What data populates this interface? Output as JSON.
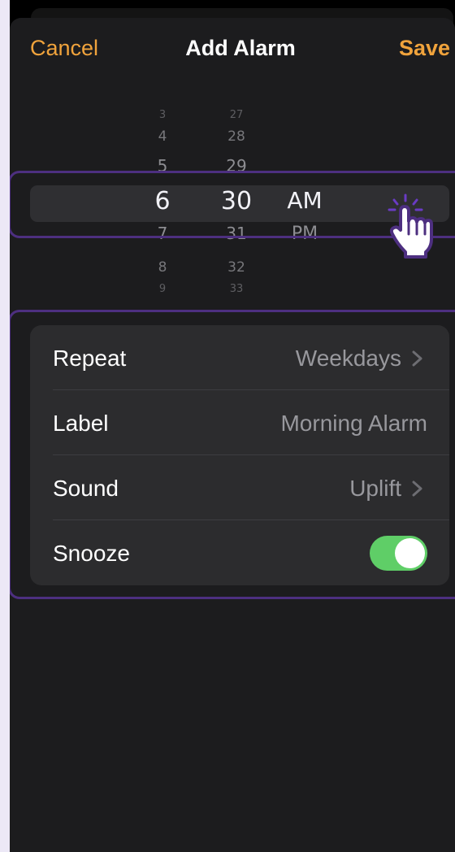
{
  "header": {
    "cancel": "Cancel",
    "title": "Add Alarm",
    "save": "Save"
  },
  "picker": {
    "hours": [
      "3",
      "4",
      "5",
      "6",
      "7",
      "8",
      "9"
    ],
    "minutes": [
      "27",
      "28",
      "29",
      "30",
      "31",
      "32",
      "33"
    ],
    "period": [
      "AM",
      "PM"
    ],
    "selected": {
      "hour": "6",
      "minute": "30",
      "period": "AM"
    }
  },
  "settings": {
    "repeat": {
      "label": "Repeat",
      "value": "Weekdays"
    },
    "label": {
      "label": "Label",
      "value": "Morning Alarm"
    },
    "sound": {
      "label": "Sound",
      "value": "Uplift"
    },
    "snooze": {
      "label": "Snooze",
      "on": true
    }
  },
  "colors": {
    "accent": "#f0a33c",
    "toggle_on": "#5fce67",
    "highlight": "#4d2f80",
    "background": "#1c1c1e"
  },
  "icons": [
    "chevron-right-icon",
    "pointer-hand-icon"
  ]
}
